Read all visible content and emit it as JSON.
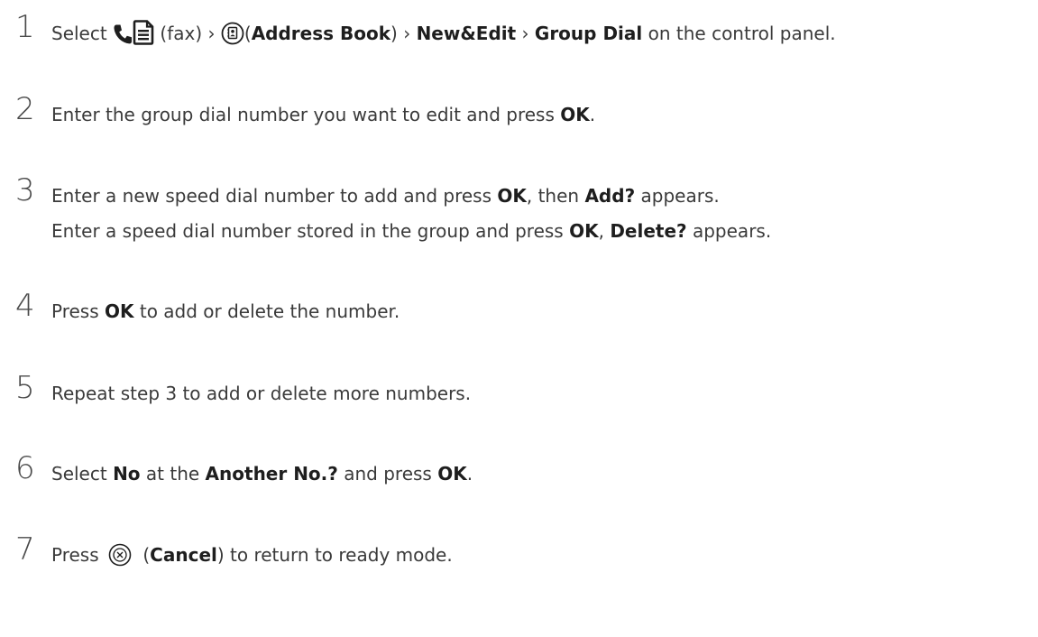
{
  "steps": [
    {
      "number": "1",
      "t1": "Select",
      "fax_label": "(fax) ›",
      "paren_open": "(",
      "address_book": "Address Book",
      "sep_close": ") ›",
      "new_edit": "New&Edit",
      "sep": "›",
      "group_dial": "Group Dial",
      "t_end": "on the control panel.",
      "icons": [
        "phone-icon",
        "fax-document-icon",
        "address-book-icon"
      ]
    },
    {
      "number": "2",
      "t1": "Enter the group dial number you want to edit and press",
      "ok": "OK",
      "t_end": "."
    },
    {
      "number": "3",
      "line1": {
        "t1": "Enter a new speed dial number to add and press",
        "ok": "OK",
        "t2": ", then",
        "add": "Add?",
        "t_end": "appears."
      },
      "line2": {
        "t1": "Enter a speed dial number stored in the group and press",
        "ok": "OK",
        "t2": ",",
        "delete": "Delete?",
        "t_end": "appears."
      }
    },
    {
      "number": "4",
      "t1": "Press",
      "ok": "OK",
      "t_end": "to add or delete the number."
    },
    {
      "number": "5",
      "t1": "Repeat step 3 to add or delete more numbers."
    },
    {
      "number": "6",
      "t1": "Select",
      "no": "No",
      "t2": "at the",
      "another": "Another No.?",
      "t3": "and press",
      "ok": "OK",
      "t_end": "."
    },
    {
      "number": "7",
      "t1": "Press",
      "paren_open": "(",
      "cancel": "Cancel",
      "t_end": ") to return to ready mode.",
      "icons": [
        "cancel-icon"
      ]
    }
  ]
}
